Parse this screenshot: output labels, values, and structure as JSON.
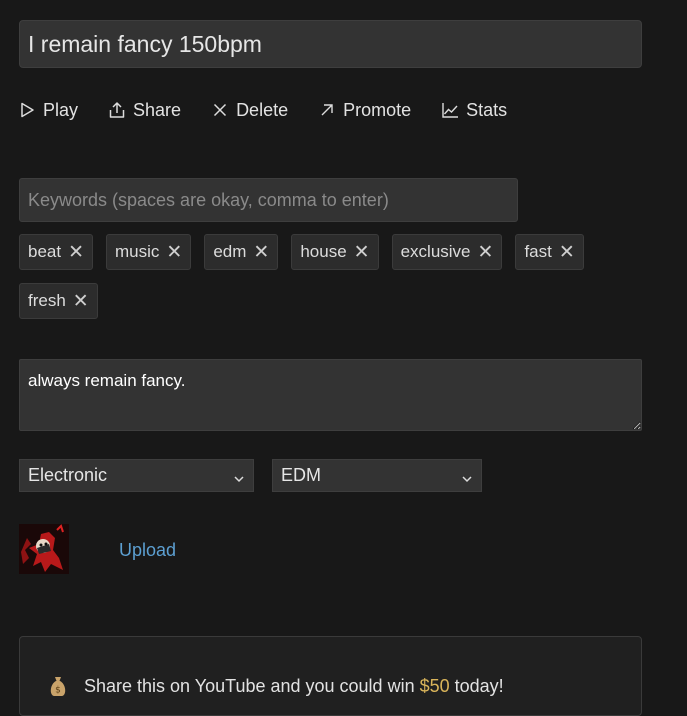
{
  "title_value": "I remain fancy 150bpm",
  "actions": [
    {
      "label": "Play",
      "icon": "play-icon"
    },
    {
      "label": "Share",
      "icon": "share-icon"
    },
    {
      "label": "Delete",
      "icon": "close-icon"
    },
    {
      "label": "Promote",
      "icon": "arrow-up-right-icon"
    },
    {
      "label": "Stats",
      "icon": "chart-line-icon"
    }
  ],
  "keywords": {
    "placeholder": "Keywords (spaces are okay, comma to enter)",
    "tags": [
      "beat",
      "music",
      "edm",
      "house",
      "exclusive",
      "fast",
      "fresh"
    ],
    "remove_glyph": "✕"
  },
  "description_value": "always remain fancy. ",
  "genre_select": {
    "selected": "Electronic"
  },
  "subgenre_select": {
    "selected": "EDM"
  },
  "upload_label": "Upload",
  "promo": {
    "icon": "money-bag-icon",
    "text_before": "Share this on YouTube and you could win",
    "amount": "$50",
    "text_after": "today!",
    "accent": "#d9b45a"
  }
}
